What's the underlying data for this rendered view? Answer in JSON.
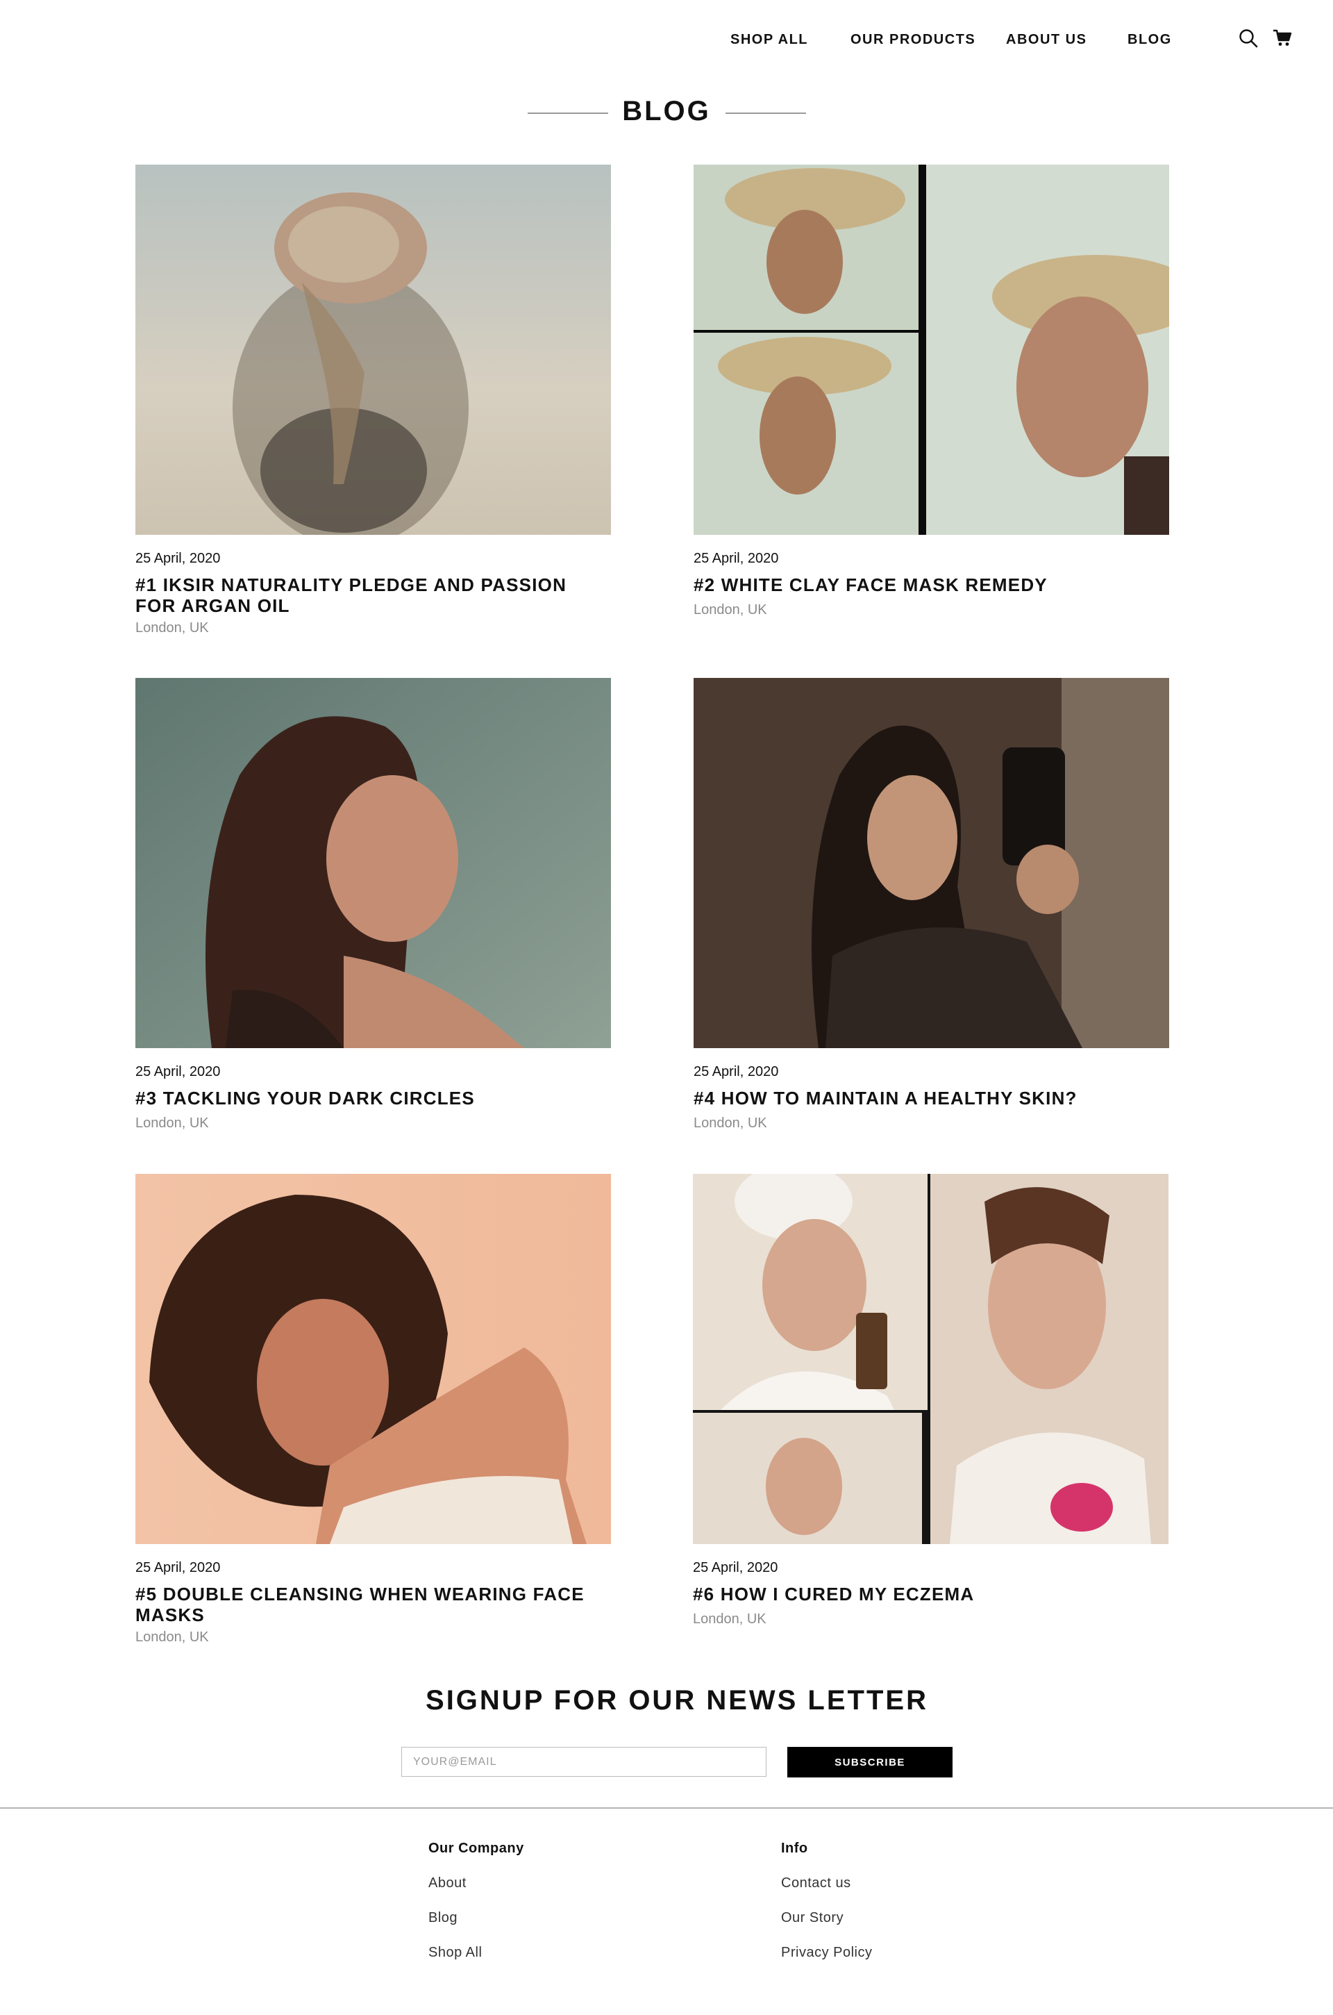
{
  "nav": {
    "items": [
      "SHOP ALL",
      "OUR PRODUCTS",
      "ABOUT US",
      "BLOG"
    ],
    "icons": [
      "search-icon",
      "cart-icon"
    ]
  },
  "blog": {
    "heading": "BLOG",
    "posts": [
      {
        "date": "25 April, 2020",
        "title": "#1 IKSIR NATURALITY PLEDGE AND PASSION FOR ARGAN OIL",
        "location": "London, UK"
      },
      {
        "date": "25 April, 2020",
        "title": "#2 WHITE CLAY FACE MASK REMEDY",
        "location": "London, UK"
      },
      {
        "date": "25 April, 2020",
        "title": "#3 TACKLING YOUR DARK CIRCLES",
        "location": "London, UK"
      },
      {
        "date": "25 April, 2020",
        "title": "#4 HOW TO MAINTAIN A HEALTHY SKIN?",
        "location": "London, UK"
      },
      {
        "date": "25 April, 2020",
        "title": "#5 DOUBLE CLEANSING WHEN WEARING FACE MASKS",
        "location": "London, UK"
      },
      {
        "date": "25 April, 2020",
        "title": "#6 HOW I CURED MY ECZEMA",
        "location": "London, UK"
      }
    ]
  },
  "newsletter": {
    "title": "SIGNUP FOR OUR NEWS LETTER",
    "placeholder": "YOUR@EMAIL",
    "button": "SUBSCRIBE"
  },
  "footer": {
    "company": {
      "heading": "Our Company",
      "links": [
        "About",
        "Blog",
        "Shop All"
      ]
    },
    "info": {
      "heading": "Info",
      "links": [
        "Contact us",
        "Our Story",
        "Privacy Policy"
      ]
    }
  },
  "colors": {
    "text": "#111111",
    "muted": "#8a8a8a",
    "button_bg": "#000000",
    "divider": "#b5b5b5"
  }
}
